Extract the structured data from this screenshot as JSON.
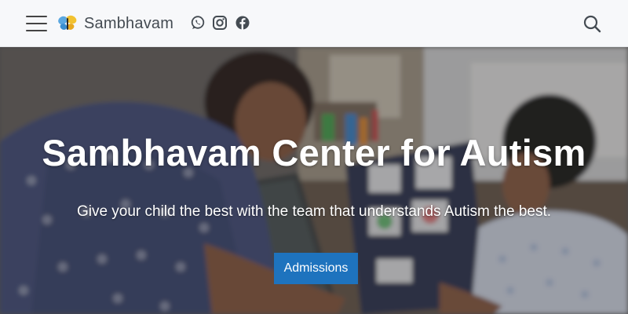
{
  "header": {
    "menu_icon": "hamburger-menu-icon",
    "logo_icon": "butterfly-logo-icon",
    "site_name": "Sambhavam",
    "social": [
      {
        "name": "whatsapp",
        "icon": "whatsapp-icon"
      },
      {
        "name": "instagram",
        "icon": "instagram-icon"
      },
      {
        "name": "facebook",
        "icon": "facebook-icon"
      }
    ],
    "search_icon": "search-icon"
  },
  "hero": {
    "title": "Sambhavam Center for Autism",
    "subtitle": "Give your child the best with the team that understands Autism the best.",
    "cta_label": "Admissions"
  },
  "colors": {
    "header_bg": "#f7f8fa",
    "icon": "#444b52",
    "cta_bg": "#1e73be",
    "hero_text": "#ffffff"
  }
}
